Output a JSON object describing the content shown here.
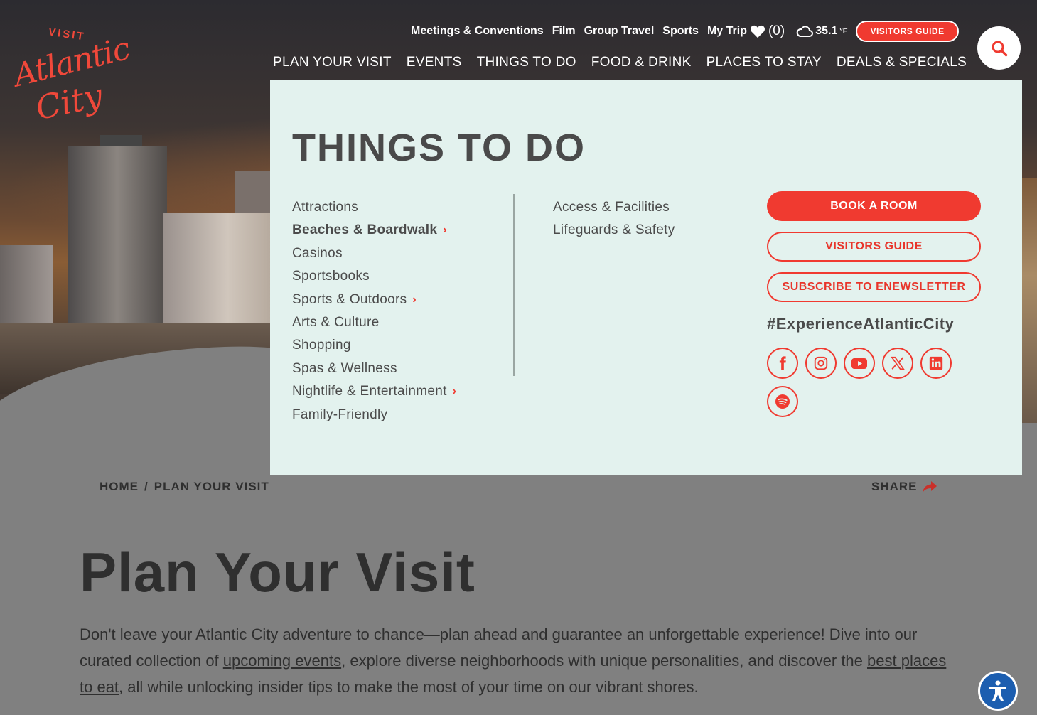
{
  "brand": {
    "visit": "VISIT",
    "atlantic": "Atlantic",
    "city": "City",
    "accent": "#f03a30"
  },
  "utility_nav": {
    "items": [
      "Meetings & Conventions",
      "Film",
      "Group Travel",
      "Sports"
    ],
    "my_trip_label": "My Trip",
    "trip_count": "(0)",
    "weather": "35.1",
    "weather_unit": "°F",
    "visitors_guide_button": "VISITORS GUIDE"
  },
  "main_nav": {
    "items": [
      "PLAN YOUR VISIT",
      "EVENTS",
      "THINGS TO DO",
      "FOOD & DRINK",
      "PLACES TO STAY",
      "DEALS & SPECIALS"
    ],
    "active": "THINGS TO DO"
  },
  "dropdown": {
    "title": "THINGS TO DO",
    "col1": [
      "Attractions",
      "Beaches & Boardwalk",
      "Casinos",
      "Sportsbooks",
      "Sports & Outdoors",
      "Arts & Culture",
      "Shopping",
      "Spas & Wellness",
      "Nightlife & Entertainment",
      "Family-Friendly"
    ],
    "col2": [
      "Access & Facilities",
      "Lifeguards & Safety"
    ],
    "book_room": "BOOK A ROOM",
    "visitors_guide": "VISITORS GUIDE",
    "subscribe": "SUBSCRIBE TO ENEWSLETTER",
    "hashtag": "#ExperienceAtlanticCity"
  },
  "breadcrumb": {
    "home": "HOME",
    "sep": "/",
    "current": "PLAN YOUR VISIT"
  },
  "share_label": "SHARE",
  "page": {
    "title": "Plan Your Visit",
    "intro_1": "Don't leave your Atlantic City adventure to chance—plan ahead and guarantee an unforgettable experience! Dive into our curated collection of ",
    "link_events": "upcoming events",
    "intro_2": ", explore diverse neighborhoods with unique personalities, and discover the ",
    "link_eat": "best places to eat",
    "intro_3": ", all while unlocking insider tips to make the most of your time on our vibrant shores."
  }
}
